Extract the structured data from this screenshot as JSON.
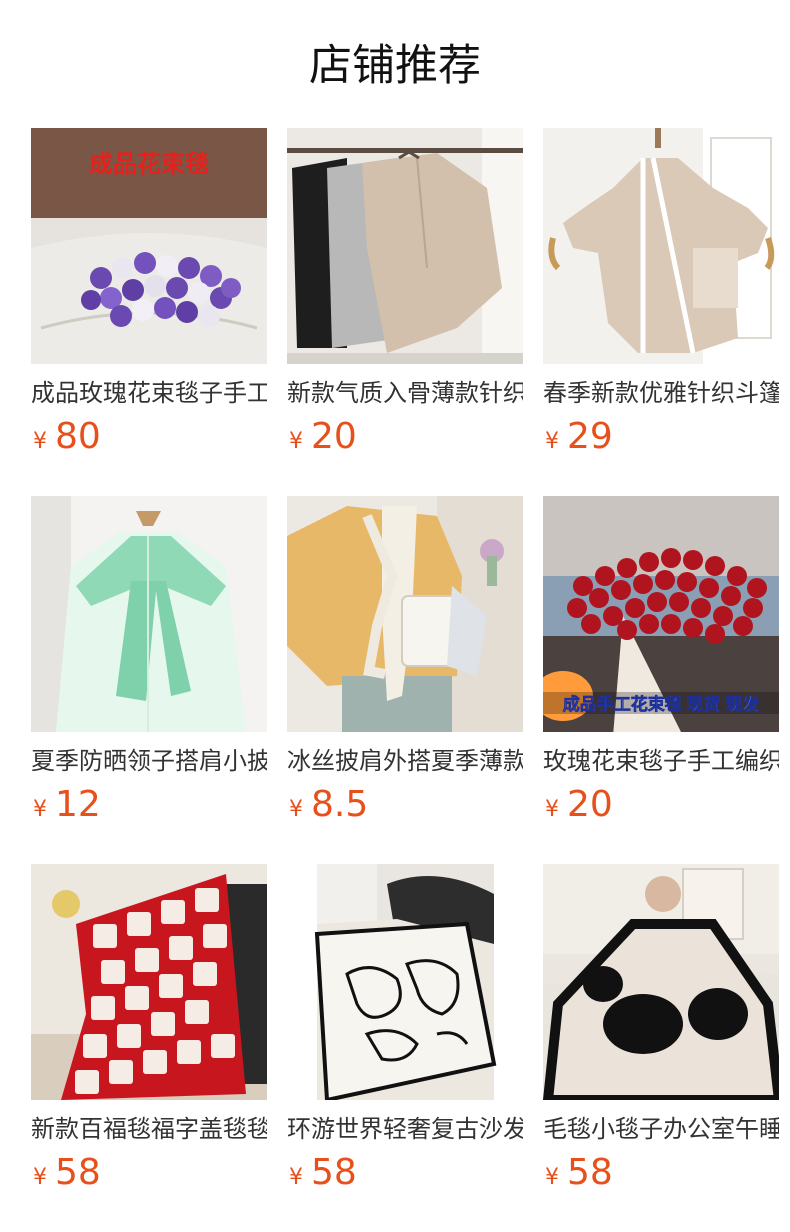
{
  "section": {
    "title": "店铺推荐"
  },
  "currency_symbol": "¥",
  "accent_color": "#e8501b",
  "products": [
    {
      "name": "成品玫瑰花束毯子手工",
      "price": "80",
      "image_label": "成品花束毯"
    },
    {
      "name": "新款气质入骨薄款针织",
      "price": "20"
    },
    {
      "name": "春季新款优雅针织斗篷",
      "price": "29"
    },
    {
      "name": "夏季防晒领子搭肩小披",
      "price": "12"
    },
    {
      "name": "冰丝披肩外搭夏季薄款",
      "price": "8.5"
    },
    {
      "name": "玫瑰花束毯子手工编织",
      "price": "20",
      "image_label": "成品手工花束毯 现货 现发"
    },
    {
      "name": "新款百福毯福字盖毯毯",
      "price": "58"
    },
    {
      "name": "环游世界轻奢复古沙发",
      "price": "58"
    },
    {
      "name": "毛毯小毯子办公室午睡",
      "price": "58"
    }
  ]
}
